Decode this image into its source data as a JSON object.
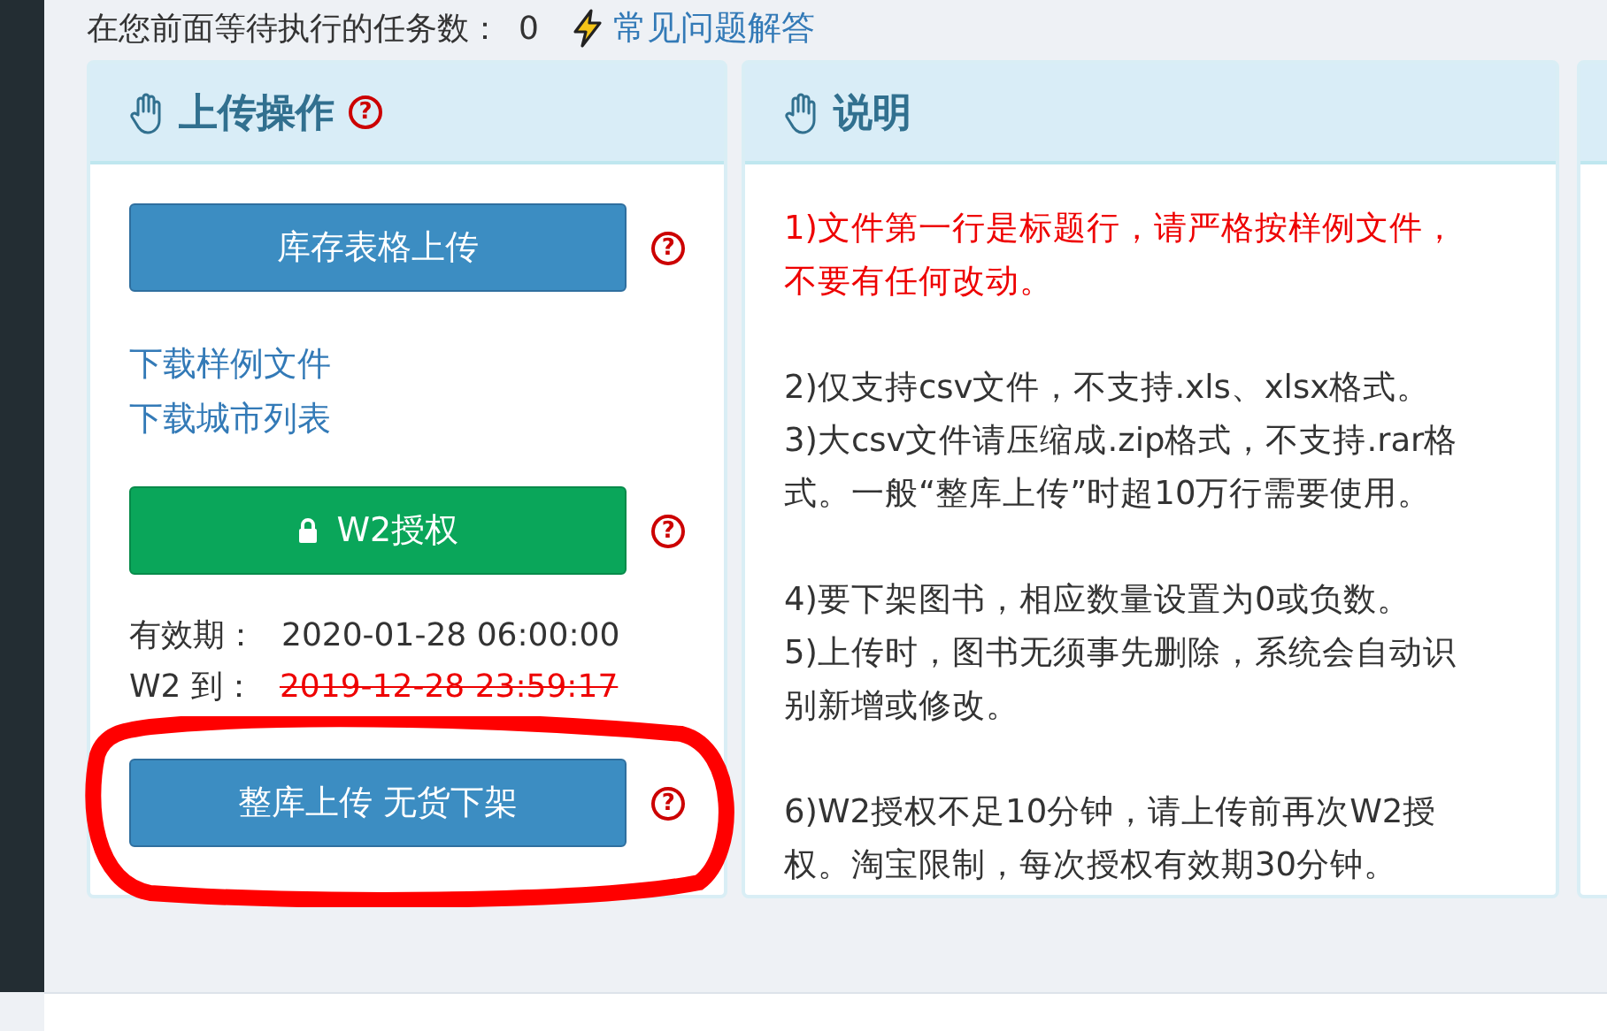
{
  "queue": {
    "label": "在您前面等待执行的任务数：",
    "count": "0",
    "faq_link": "常见问题解答"
  },
  "upload_panel": {
    "title": "上传操作",
    "help": "?",
    "upload_button": {
      "label": "库存表格上传",
      "help": "?"
    },
    "links": [
      {
        "label": "下载样例文件"
      },
      {
        "label": "下载城市列表"
      }
    ],
    "auth_button": {
      "label": "W2授权",
      "help": "?"
    },
    "validity": {
      "label": "有效期：",
      "value": "2020-01-28 06:00:00",
      "expired": false
    },
    "w2_expiry": {
      "label": "W2 到：",
      "value": "2019-12-28 23:59:17",
      "expired": true
    },
    "full_upload_button": {
      "label": "整库上传 无货下架",
      "help": "?"
    }
  },
  "notes_panel": {
    "title": "说明",
    "groups": [
      {
        "notes": [
          {
            "text": "1)文件第一行是标题行，请严格按样例文件，不要有任何改动。",
            "kind": "warning"
          }
        ]
      },
      {
        "notes": [
          {
            "text": "2)仅支持csv文件，不支持.xls、xlsx格式。",
            "kind": "normal"
          },
          {
            "text": "3)大csv文件请压缩成.zip格式，不支持.rar格式。一般“整库上传”时超10万行需要使用。",
            "kind": "normal"
          }
        ]
      },
      {
        "notes": [
          {
            "text": "4)要下架图书，相应数量设置为0或负数。",
            "kind": "normal"
          },
          {
            "text": "5)上传时，图书无须事先删除，系统会自动识别新增或修改。",
            "kind": "normal"
          }
        ]
      },
      {
        "notes": [
          {
            "text": "6)W2授权不足10分钟，请上传前再次W2授权。淘宝限制，每次授权有效期30分钟。",
            "kind": "normal"
          }
        ]
      }
    ]
  },
  "annotation": {
    "kind": "ellipse"
  }
}
